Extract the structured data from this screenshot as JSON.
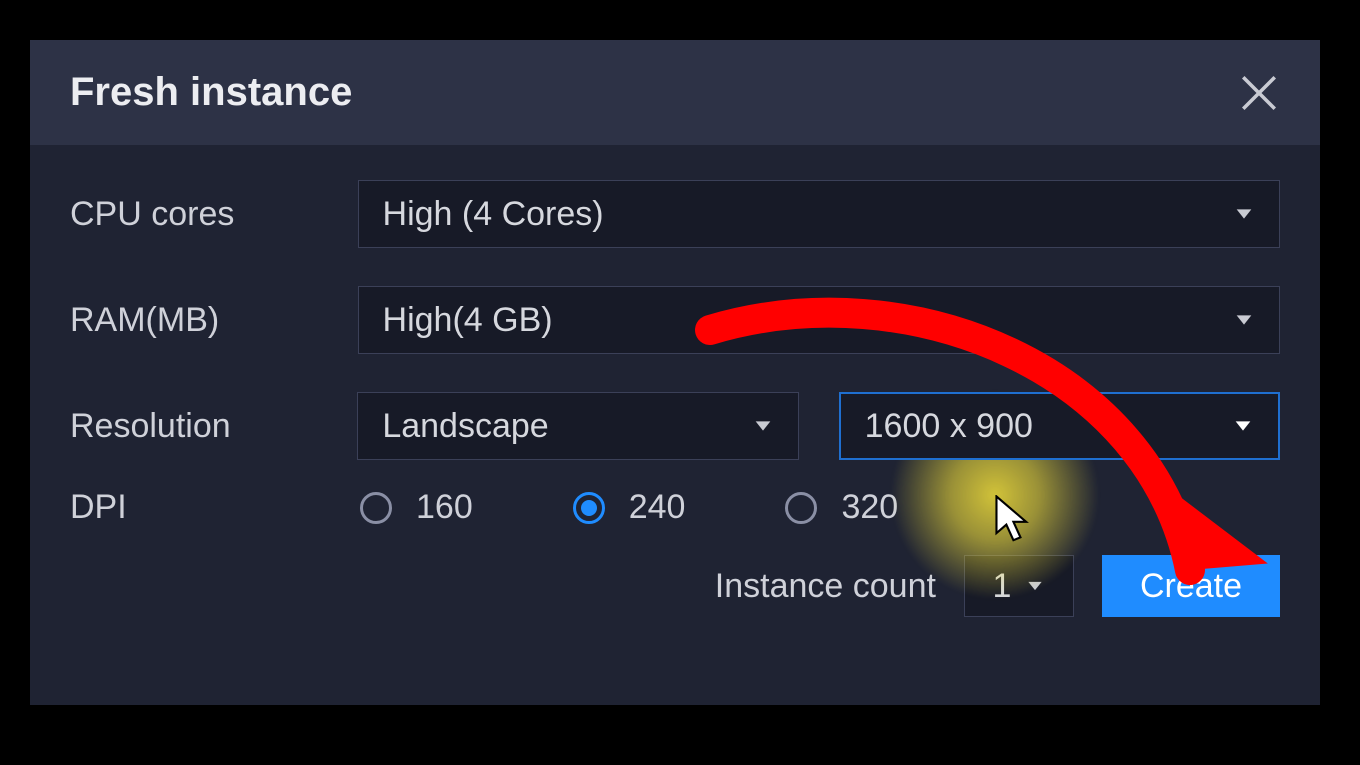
{
  "dialog": {
    "title": "Fresh instance"
  },
  "fields": {
    "cpu_label": "CPU cores",
    "cpu_value": "High (4 Cores)",
    "ram_label": "RAM(MB)",
    "ram_value": "High(4 GB)",
    "resolution_label": "Resolution",
    "orientation_value": "Landscape",
    "resolution_value": "1600 x 900",
    "dpi_label": "DPI",
    "dpi_options": {
      "opt1": "160",
      "opt2": "240",
      "opt3": "320"
    },
    "dpi_selected": "240"
  },
  "footer": {
    "count_label": "Instance count",
    "count_value": "1",
    "create_label": "Create"
  },
  "annotation": {
    "arrow_color": "#ff0000",
    "highlight_color": "#ffeb3b"
  }
}
